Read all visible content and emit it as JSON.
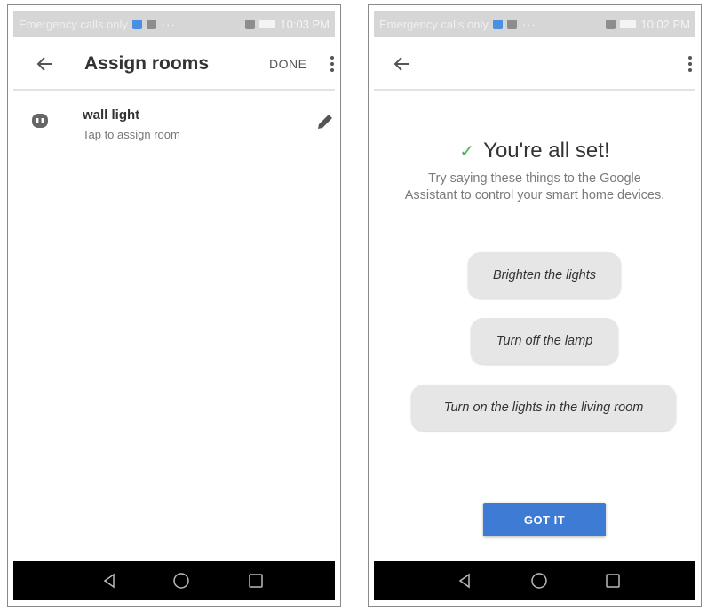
{
  "left_screen": {
    "status": {
      "carrier": "Emergency calls only",
      "time": "10:03 PM"
    },
    "appbar": {
      "title": "Assign rooms",
      "done_label": "DONE"
    },
    "device": {
      "name": "wall light",
      "subtitle": "Tap to assign room",
      "icon": "plug-icon"
    }
  },
  "right_screen": {
    "status": {
      "carrier": "Emergency calls only",
      "time": "10:02 PM"
    },
    "success": {
      "title": "You're all set!",
      "subtitle": "Try saying these things to the Google Assistant to control your smart home devices."
    },
    "suggestions": [
      "Brighten the lights",
      "Turn off the lamp",
      "Turn on the lights in the living room"
    ],
    "got_it_label": "GOT IT"
  },
  "colors": {
    "accent_button": "#3d7bd4",
    "check": "#4caf50",
    "status_bar": "#d6d6d6",
    "nav_bar": "#000000",
    "chip": "#e6e6e6"
  },
  "icons": [
    "back-arrow-icon",
    "more-vert-icon",
    "plug-icon",
    "pencil-icon",
    "check-icon",
    "nav-back-icon",
    "nav-home-icon",
    "nav-recent-icon"
  ]
}
